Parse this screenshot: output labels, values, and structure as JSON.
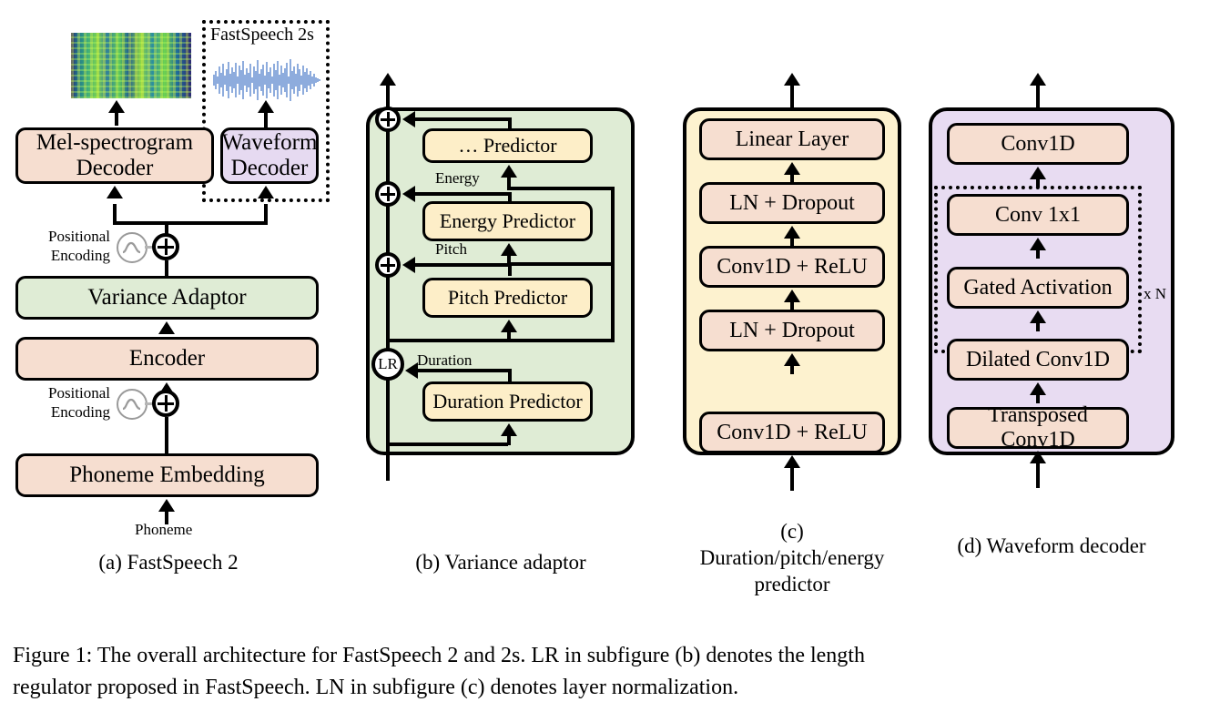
{
  "figure": {
    "caption": "Figure 1: The overall architecture for FastSpeech 2 and 2s. LR in subfigure (b) denotes the length\nregulator proposed in FastSpeech. LN in subfigure (c) denotes layer normalization."
  },
  "colors": {
    "peach": "#f6ded0",
    "cream": "#fdeec8",
    "lilac": "#e6daf1",
    "group_green": "#dfecd5",
    "group_yellow": "#fdf2cf",
    "group_purple": "#e8dcf2",
    "stroke": "#000000",
    "waveform_blue": "#3b6fc4"
  },
  "subfigure_a": {
    "caption": "(a) FastSpeech 2",
    "dashed_group_label": "FastSpeech 2s",
    "input_label": "Phoneme",
    "positional_encoding_label": "Positional\nEncoding",
    "nodes": [
      {
        "id": "phoneme-embedding",
        "label": "Phoneme Embedding",
        "color": "peach"
      },
      {
        "id": "encoder",
        "label": "Encoder",
        "color": "peach"
      },
      {
        "id": "variance-adaptor",
        "label": "Variance Adaptor",
        "color": "green"
      },
      {
        "id": "mel-spectrogram-decoder",
        "label": "Mel-spectrogram\nDecoder",
        "color": "peach"
      },
      {
        "id": "waveform-decoder",
        "label": "Waveform\nDecoder",
        "color": "lilac"
      }
    ],
    "outputs": [
      {
        "id": "mel-spectrogram-image",
        "kind": "spectrogram"
      },
      {
        "id": "waveform-image",
        "kind": "waveform"
      }
    ]
  },
  "subfigure_b": {
    "caption": "(b) Variance adaptor",
    "nodes": [
      {
        "id": "duration-predictor",
        "label": "Duration Predictor",
        "color": "cream"
      },
      {
        "id": "pitch-predictor",
        "label": "Pitch Predictor",
        "color": "cream"
      },
      {
        "id": "energy-predictor",
        "label": "Energy Predictor",
        "color": "cream"
      },
      {
        "id": "other-predictor",
        "label": "… Predictor",
        "color": "cream"
      }
    ],
    "edge_labels": [
      "Duration",
      "Pitch",
      "Energy"
    ],
    "operators": [
      {
        "id": "length-regulator",
        "label": "LR"
      },
      {
        "id": "add-pitch",
        "label": "+"
      },
      {
        "id": "add-energy",
        "label": "+"
      },
      {
        "id": "add-other",
        "label": "+"
      }
    ]
  },
  "subfigure_c": {
    "caption": "(c)\nDuration/pitch/energy\npredictor",
    "nodes": [
      {
        "id": "conv1d-relu-1",
        "label": "Conv1D + ReLU",
        "color": "peach"
      },
      {
        "id": "ln-dropout-1",
        "label": "LN + Dropout",
        "color": "peach"
      },
      {
        "id": "conv1d-relu-2",
        "label": "Conv1D + ReLU",
        "color": "peach"
      },
      {
        "id": "ln-dropout-2",
        "label": "LN + Dropout",
        "color": "peach"
      },
      {
        "id": "linear-layer",
        "label": "Linear Layer",
        "color": "peach"
      }
    ]
  },
  "subfigure_d": {
    "caption": "(d) Waveform decoder",
    "repeat_label": "x N",
    "nodes": [
      {
        "id": "transposed-conv1d",
        "label": "Transposed Conv1D",
        "color": "peach"
      },
      {
        "id": "dilated-conv1d",
        "label": "Dilated Conv1D",
        "color": "peach"
      },
      {
        "id": "gated-activation",
        "label": "Gated Activation",
        "color": "peach"
      },
      {
        "id": "conv-1x1",
        "label": "Conv 1x1",
        "color": "peach"
      },
      {
        "id": "conv1d-out",
        "label": "Conv1D",
        "color": "peach"
      }
    ]
  }
}
